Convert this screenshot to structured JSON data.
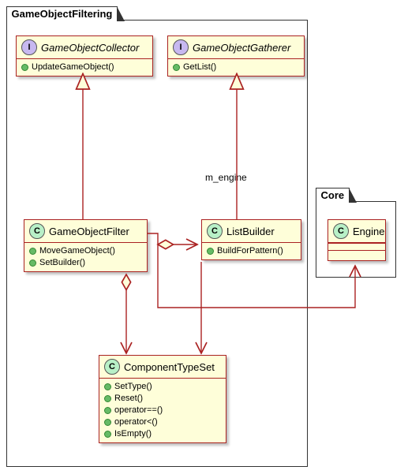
{
  "packages": {
    "filtering": {
      "name": "GameObjectFiltering"
    },
    "core": {
      "name": "Core"
    }
  },
  "classes": {
    "collector": {
      "stereotype": "I",
      "name": "GameObjectCollector",
      "methods": [
        "UpdateGameObject()"
      ]
    },
    "gatherer": {
      "stereotype": "I",
      "name": "GameObjectGatherer",
      "methods": [
        "GetList()"
      ]
    },
    "filter": {
      "stereotype": "C",
      "name": "GameObjectFilter",
      "methods": [
        "MoveGameObject()",
        "SetBuilder()"
      ]
    },
    "listbuilder": {
      "stereotype": "C",
      "name": "ListBuilder",
      "methods": [
        "BuildForPattern()"
      ]
    },
    "cts": {
      "stereotype": "C",
      "name": "ComponentTypeSet",
      "methods": [
        "SetType()",
        "Reset()",
        "operator==()",
        "operator<()",
        "IsEmpty()"
      ]
    },
    "engine": {
      "stereotype": "C",
      "name": "Engine",
      "methods": []
    }
  },
  "labels": {
    "m_engine": "m_engine"
  }
}
